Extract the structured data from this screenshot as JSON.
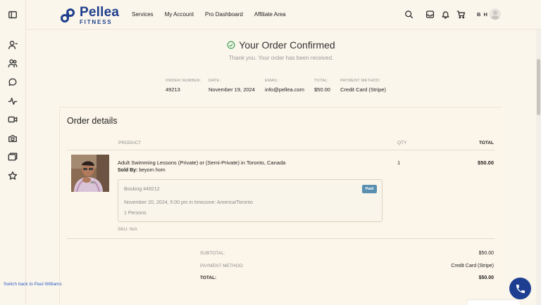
{
  "brand": {
    "name": "Pellea",
    "sub": "FITNESS",
    "color": "#1d3f8c"
  },
  "nav": [
    "Services",
    "My Account",
    "Pro Dashboard",
    "Affiliate Area"
  ],
  "header": {
    "icons": [
      "search-icon",
      "inbox-icon",
      "bell-icon",
      "cart-icon"
    ],
    "user_initials": "B H"
  },
  "sidebar_icons": [
    "panel-toggle-icon",
    "user-icon",
    "users-icon",
    "chat-icon",
    "activity-icon",
    "video-icon",
    "camera-icon",
    "folder-icon",
    "star-icon"
  ],
  "confirmation": {
    "title": "Your Order Confirmed",
    "subtitle": "Thank you. Your order has been received.",
    "accent": "#3fa15a"
  },
  "order_meta": [
    {
      "label": "ORDER NUMBER:",
      "value": "49213"
    },
    {
      "label": "DATE:",
      "value": "November 19, 2024"
    },
    {
      "label": "EMAIL:",
      "value": "info@pellea.com"
    },
    {
      "label": "TOTAL:",
      "value": "$50.00"
    },
    {
      "label": "PAYMENT METHOD:",
      "value": "Credit Card (Stripe)"
    }
  ],
  "order_details": {
    "title": "Order details",
    "columns": {
      "product": "PRODUCT",
      "qty": "QTY",
      "total": "TOTAL"
    },
    "item": {
      "name": "Adult Swimming Lessons (Private) or (Semi-Private) in Toronto, Canada",
      "sold_by_label": "Sold By:",
      "sold_by": "beyorn horn",
      "qty": "1",
      "total": "$50.00",
      "booking": {
        "number": "Booking #49212",
        "status": "Paid",
        "status_color": "#5a8fb0",
        "datetime": "November 20, 2024, 5:00 pm in timezone: America/Toronto",
        "persons": "1 Persons"
      },
      "sku": "SKU: N/A"
    },
    "summary": [
      {
        "label": "SUBTOTAL:",
        "value": "$50.00"
      },
      {
        "label": "PAYMENT METHOD:",
        "value": "Credit Card (Stripe)"
      },
      {
        "label": "TOTAL:",
        "value": "$50.00"
      }
    ]
  },
  "switch_back": "Switch back to Paul Williams",
  "support_button_color": "#1e3f91"
}
